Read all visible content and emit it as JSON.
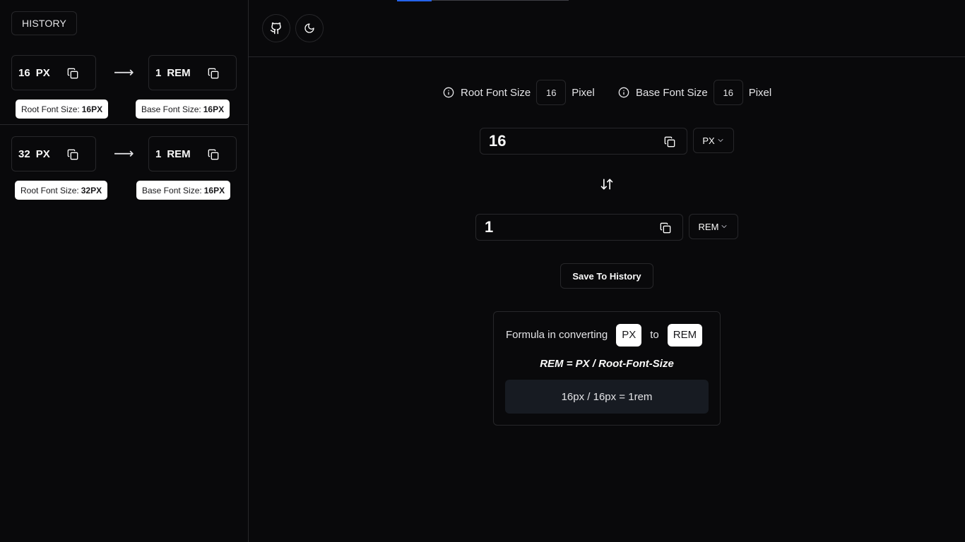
{
  "sidebar": {
    "history_label": "HISTORY",
    "entries": [
      {
        "from_value": "16",
        "from_unit": "PX",
        "to_value": "1",
        "to_unit": "REM",
        "root_label": "Root Font Size:",
        "root_value": "16PX",
        "base_label": "Base Font Size:",
        "base_value": "16PX"
      },
      {
        "from_value": "32",
        "from_unit": "PX",
        "to_value": "1",
        "to_unit": "REM",
        "root_label": "Root Font Size:",
        "root_value": "32PX",
        "base_label": "Base Font Size:",
        "base_value": "16PX"
      }
    ],
    "arrow": "⟶"
  },
  "header": {
    "icons": [
      "github-icon",
      "moon-icon"
    ]
  },
  "settings": {
    "root_label": "Root Font Size",
    "root_value": "16",
    "root_unit": "Pixel",
    "base_label": "Base Font Size",
    "base_value": "16",
    "base_unit": "Pixel"
  },
  "converter": {
    "from_value": "16",
    "from_unit": "PX",
    "to_value": "1",
    "to_unit": "REM",
    "save_label": "Save To History"
  },
  "formula": {
    "prefix": "Formula in converting",
    "from_unit": "PX",
    "connector": "to",
    "to_unit": "REM",
    "equation": "REM = PX / Root-Font-Size",
    "result": "16px / 16px = 1rem"
  },
  "colors": {
    "background": "#09090b",
    "border": "#27272a",
    "accent": "#2563eb",
    "chip": "#ffffff"
  }
}
